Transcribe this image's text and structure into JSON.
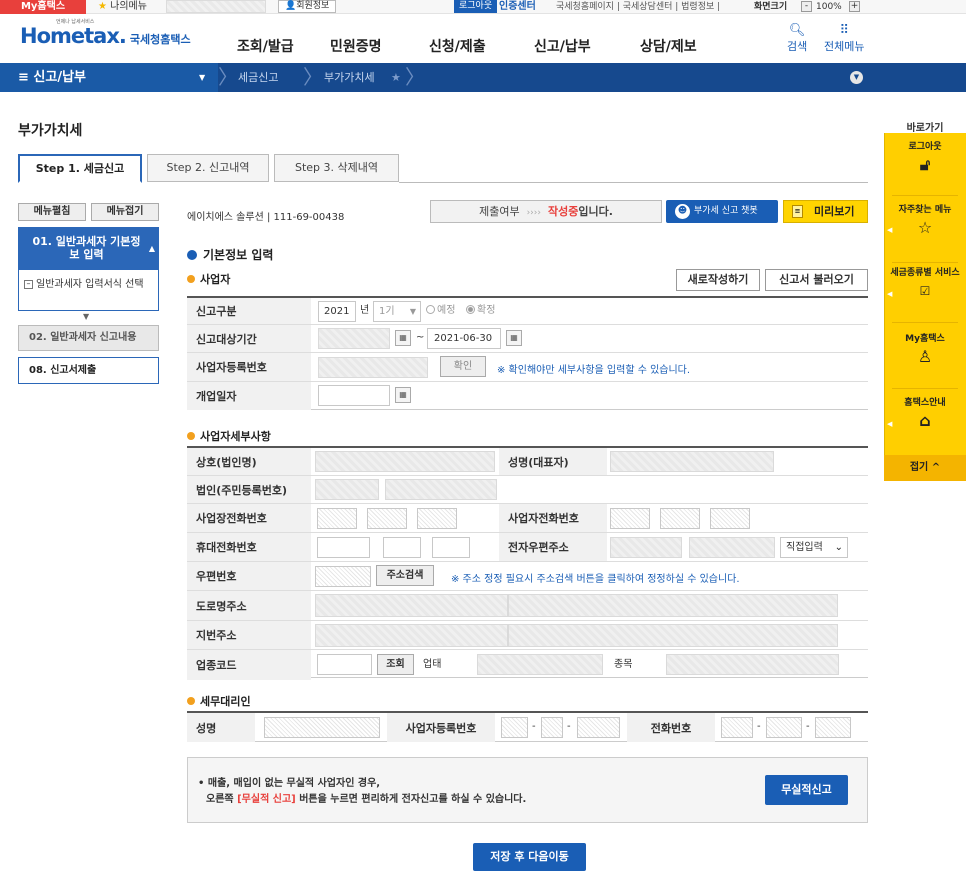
{
  "topbar": {
    "myhome": "My홈택스",
    "mymenu": "나의메뉴",
    "member": "회원정보",
    "logout": "로그아웃",
    "cert": "인증센터",
    "links": "국세청홈페이지 | 국세상담센터 | 법령정보 |",
    "zoom_label": "화면크기",
    "zoom_minus": "-",
    "zoom_value": "100%",
    "zoom_plus": "+"
  },
  "header": {
    "logo_main": "Hometax.",
    "logo_sub": "국세청홈택스",
    "logo_tiny": "언제나 납세서비스",
    "nav": [
      "조회/발급",
      "민원증명",
      "신청/제출",
      "신고/납부",
      "상담/제보"
    ],
    "search": "검색",
    "allmenu": "전체메뉴"
  },
  "gnb": {
    "main": "≡  신고/납부",
    "crumb1": "세금신고",
    "crumb2": "부가가치세"
  },
  "page": {
    "title": "부가가치세"
  },
  "tabs": [
    "Step 1. 세금신고",
    "Step 2. 신고내역",
    "Step 3. 삭제내역"
  ],
  "leftmenu": {
    "expand": "메뉴펼침",
    "collapse": "메뉴접기",
    "item1": "01. 일반과세자 기본정보 입력",
    "item1_sub": "일반과세자 입력서식 선택",
    "item2": "02. 일반과세자 신고내용",
    "item3": "08. 신고서제출"
  },
  "info": {
    "company": "에이치에스 솔루션  |  111-69-00438",
    "submit_label": "제출여부",
    "submit_dots": "››››",
    "submit_status": "작성중",
    "submit_suffix": "입니다.",
    "chatbot": "부가세 신고 챗봇",
    "preview": "미리보기"
  },
  "basic": {
    "title": "기본정보 입력",
    "biz_title": "사업자",
    "new_write": "새로작성하기",
    "load": "신고서 불러오기",
    "fields": {
      "report_type": "신고구분",
      "report_period": "신고대상기간",
      "biz_reg_no": "사업자등록번호",
      "open_date": "개업일자"
    },
    "year": "2021",
    "year_unit": "년",
    "term": "1기",
    "radio1": "예정",
    "radio2": "확정",
    "tilde": "~",
    "end_date": "2021-06-30",
    "confirm": "확인",
    "confirm_note": "※ 확인해야만 세부사항을 입력할 수 있습니다."
  },
  "detail": {
    "title": "사업자세부사항",
    "labels": {
      "trade_name": "상호(법인명)",
      "rep_name": "성명(대표자)",
      "corp_no": "법인(주민등록번호)",
      "biz_tel": "사업장전화번호",
      "owner_tel": "사업자전화번호",
      "mobile": "휴대전화번호",
      "email": "전자우편주소",
      "zip": "우편번호",
      "road_addr": "도로명주소",
      "lot_addr": "지번주소",
      "industry": "업종코드"
    },
    "email_select": "직접입력",
    "addr_search": "주소검색",
    "addr_note": "※ 주소 정정 필요시 주소검색 버튼을 클릭하여 정정하실 수 있습니다.",
    "lookup": "조회",
    "biz_type": "업태",
    "biz_item": "종목"
  },
  "agent": {
    "title": "세무대리인",
    "name": "성명",
    "reg_no": "사업자등록번호",
    "tel": "전화번호",
    "dash": "-"
  },
  "zero": {
    "line1": "• 매출, 매입이 없는 무실적 사업자인 경우,",
    "line2_a": "오른쪽 ",
    "line2_b": "[무실적 신고]",
    "line2_c": " 버튼을 누르면 편리하게 전자신고를 하실 수 있습니다.",
    "button": "무실적신고"
  },
  "save_next": "저장 후 다음이동",
  "quick": {
    "title": "바로가기",
    "items": [
      "로그아웃",
      "자주찾는 메뉴",
      "세금종류별 서비스",
      "My홈택스",
      "홈택스안내"
    ],
    "fold": "접기 ^"
  },
  "colors": {
    "primary": "#1a5eb5",
    "gnb": "#16498e",
    "accent_red": "#e8403c",
    "quick_yellow": "#ffcf00"
  }
}
